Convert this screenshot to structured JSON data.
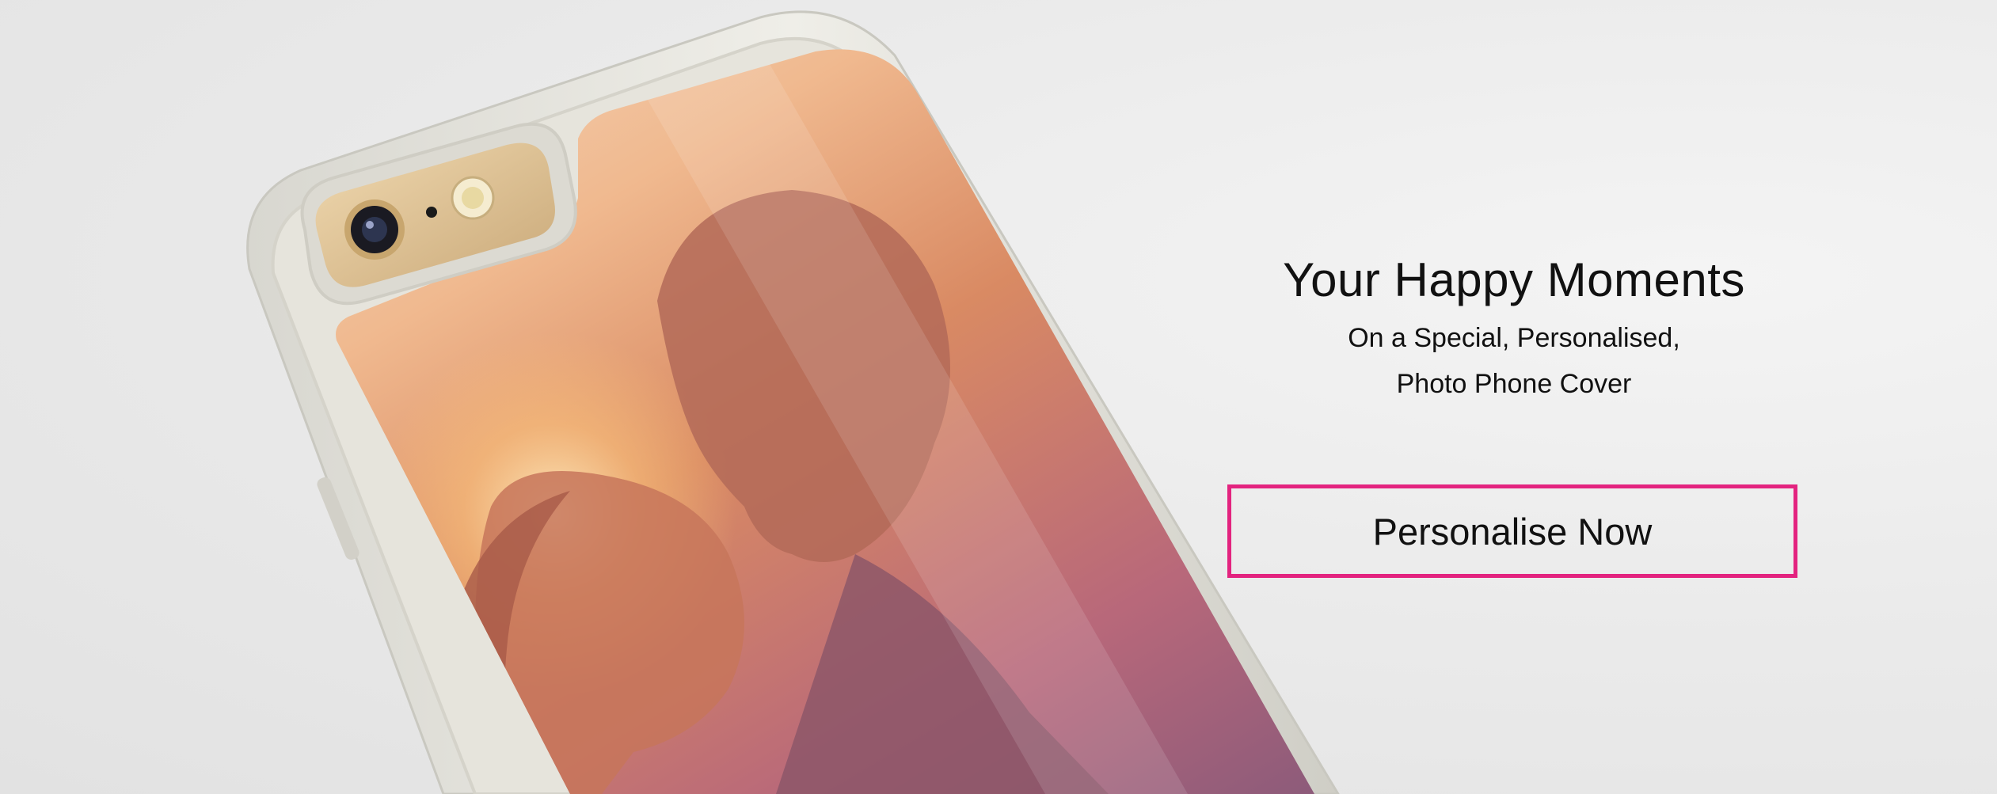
{
  "banner": {
    "headline": "Your Happy Moments",
    "subline_1": "On a Special, Personalised,",
    "subline_2": "Photo Phone Cover",
    "cta_label": "Personalise Now",
    "accent_color": "#e3237f"
  },
  "product_image": {
    "subject": "personalised photo phone case with a couple's kiss photo"
  }
}
